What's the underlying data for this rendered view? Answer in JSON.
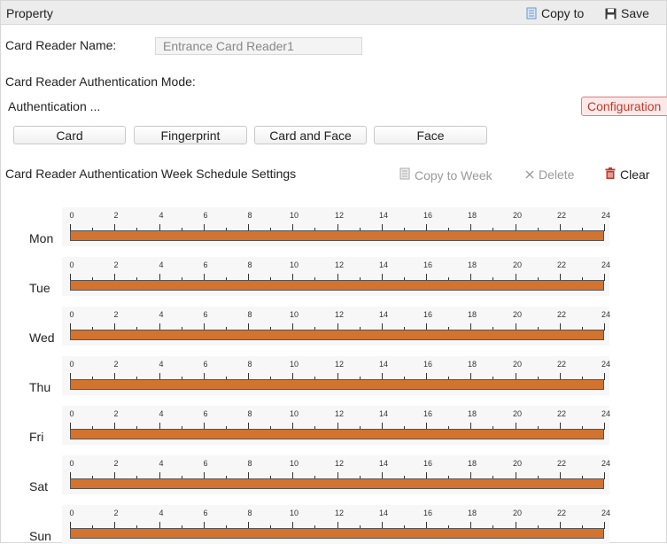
{
  "header": {
    "title": "Property",
    "copy_to": "Copy to",
    "save": "Save"
  },
  "reader_name": {
    "label": "Card Reader Name:",
    "value": "Entrance Card Reader1"
  },
  "auth_mode": {
    "label": "Card Reader Authentication Mode:",
    "sub_label": "Authentication ...",
    "config_button": "Configuration",
    "modes": [
      "Card",
      "Fingerprint",
      "Card and Face",
      "Face"
    ]
  },
  "week_schedule": {
    "label": "Card Reader Authentication Week Schedule Settings",
    "copy_to_week": "Copy to Week",
    "delete": "Delete",
    "clear": "Clear",
    "days": [
      "Mon",
      "Tue",
      "Wed",
      "Thu",
      "Fri",
      "Sat",
      "Sun"
    ],
    "tick_labels": [
      "0",
      "2",
      "4",
      "6",
      "8",
      "10",
      "12",
      "14",
      "16",
      "18",
      "20",
      "22",
      "24"
    ],
    "segments": [
      {
        "day": "Mon",
        "start": 0,
        "end": 24
      },
      {
        "day": "Tue",
        "start": 0,
        "end": 24
      },
      {
        "day": "Wed",
        "start": 0,
        "end": 24
      },
      {
        "day": "Thu",
        "start": 0,
        "end": 24
      },
      {
        "day": "Fri",
        "start": 0,
        "end": 24
      },
      {
        "day": "Sat",
        "start": 0,
        "end": 24
      },
      {
        "day": "Sun",
        "start": 0,
        "end": 24
      }
    ]
  },
  "colors": {
    "schedule_bar": "#d2732f",
    "config_text": "#c0392b",
    "accent_icon": "#4a8fd6"
  },
  "icons": {
    "copy_to": "document-copy-icon",
    "save": "floppy-disk-icon",
    "copy_to_week": "document-copy-icon",
    "delete": "close-icon",
    "clear": "trash-icon"
  }
}
